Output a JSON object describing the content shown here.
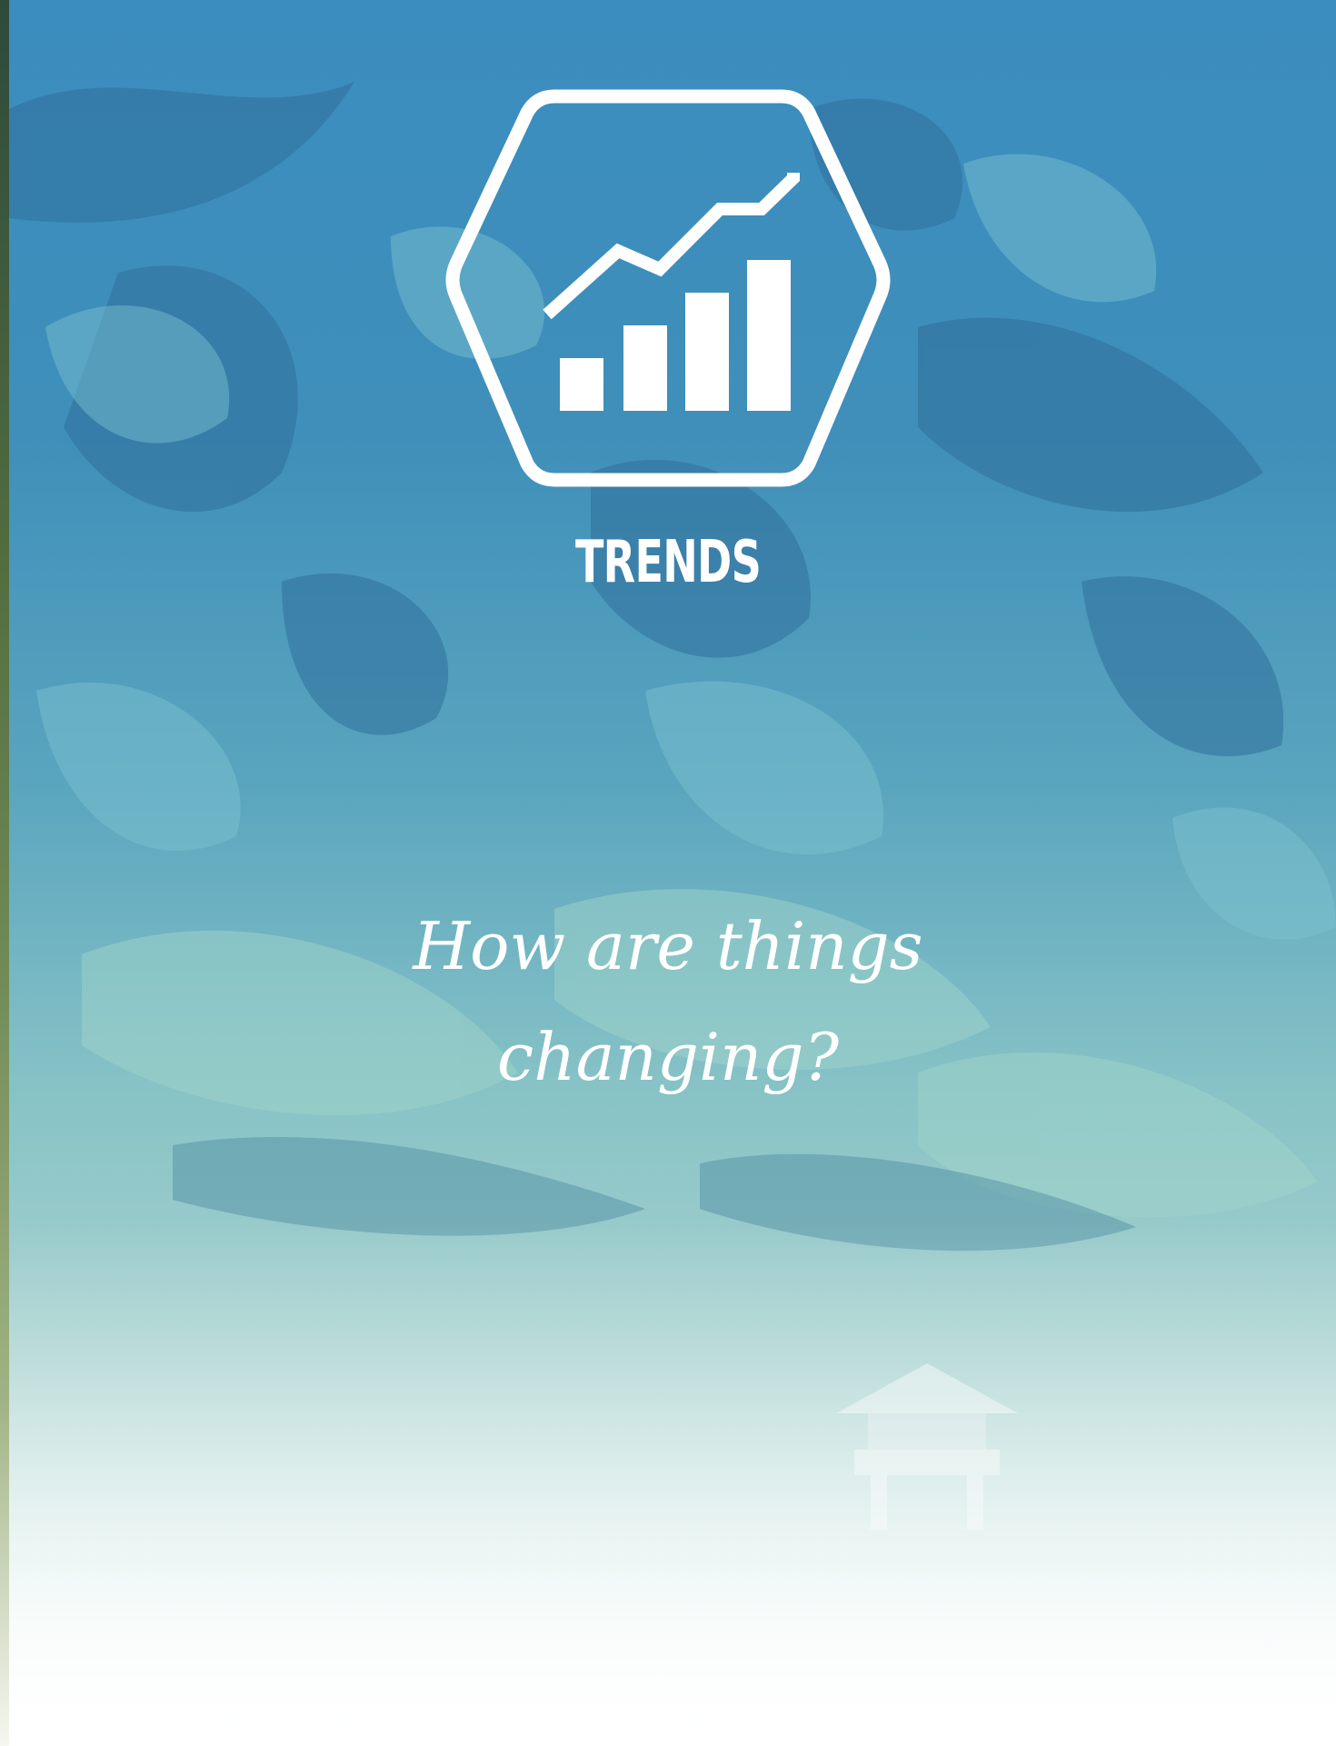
{
  "section": {
    "title": "TRENDS",
    "question": "How are things changing?"
  },
  "icon": {
    "name": "trends-chart-icon"
  },
  "colors": {
    "overlay_top": "#3f8fbd",
    "overlay_mid": "#74b7c4",
    "overlay_bottom": "#ffffff",
    "text": "#ffffff"
  }
}
